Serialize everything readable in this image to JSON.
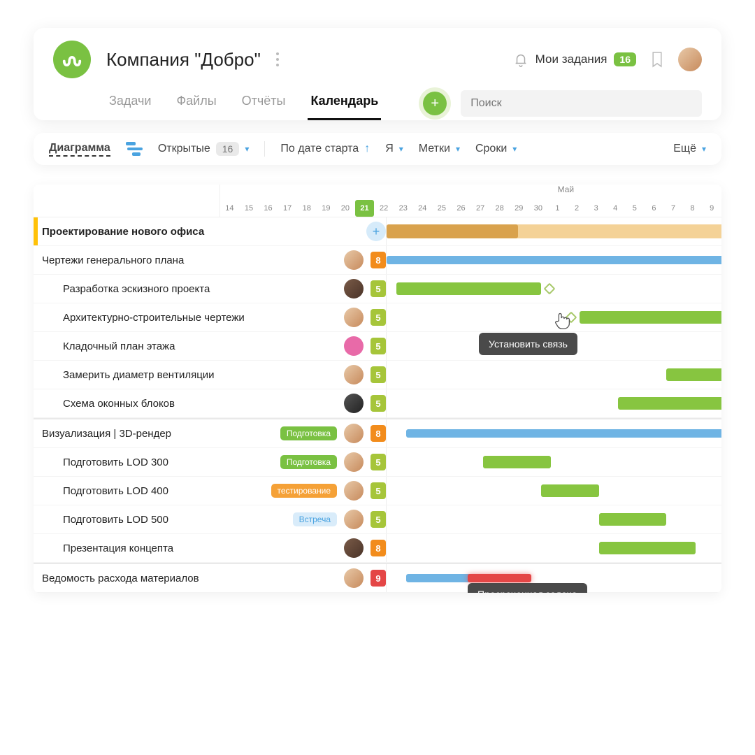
{
  "header": {
    "company_title": "Компания \"Добро\"",
    "my_tasks_label": "Мои задания",
    "my_tasks_count": "16",
    "search_placeholder": "Поиск",
    "tabs": {
      "tasks": "Задачи",
      "files": "Файлы",
      "reports": "Отчёты",
      "calendar": "Календарь"
    }
  },
  "filters": {
    "view_mode": "Диаграмма",
    "open_label": "Открытые",
    "open_count": "16",
    "sort_label": "По дате старта",
    "assignee_label": "Я",
    "tags_label": "Метки",
    "dates_label": "Сроки",
    "more_label": "Ещё"
  },
  "timeline": {
    "month_label": "Май",
    "days": [
      "14",
      "15",
      "16",
      "17",
      "18",
      "19",
      "20",
      "21",
      "22",
      "23",
      "24",
      "25",
      "26",
      "27",
      "28",
      "29",
      "30",
      "1",
      "2",
      "3",
      "4",
      "5",
      "6",
      "7",
      "8",
      "9"
    ],
    "today_index": 7
  },
  "tooltips": {
    "link": "Установить связь",
    "overdue": "Просроченная задача"
  },
  "tasks": [
    {
      "title": "Проектирование нового офиса",
      "kind": "section"
    },
    {
      "title": "Чертежи генерального плана",
      "badge": "8",
      "badge_color": "orange",
      "avatar": "tan"
    },
    {
      "title": "Разработка эскизного проекта",
      "badge": "5",
      "badge_color": "lime",
      "avatar": "brown",
      "indent": 2
    },
    {
      "title": "Архитектурно-строительные чертежи",
      "badge": "5",
      "badge_color": "lime",
      "avatar": "tan",
      "indent": 2
    },
    {
      "title": "Кладочный план этажа",
      "badge": "5",
      "badge_color": "lime",
      "avatar": "pink",
      "indent": 2
    },
    {
      "title": "Замерить диаметр вентиляции",
      "badge": "5",
      "badge_color": "lime",
      "avatar": "tan",
      "indent": 2
    },
    {
      "title": "Схема оконных блоков",
      "badge": "5",
      "badge_color": "lime",
      "avatar": "dark",
      "indent": 2
    },
    {
      "title": "Визуализация | 3D-рендер",
      "badge": "8",
      "badge_color": "orange",
      "avatar": "tan",
      "tag": "Подготовка",
      "tag_color": "green"
    },
    {
      "title": "Подготовить LOD 300",
      "badge": "5",
      "badge_color": "lime",
      "avatar": "tan",
      "indent": 2,
      "tag": "Подготовка",
      "tag_color": "green"
    },
    {
      "title": "Подготовить LOD 400",
      "badge": "5",
      "badge_color": "lime",
      "avatar": "tan",
      "indent": 2,
      "tag": "тестирование",
      "tag_color": "orange"
    },
    {
      "title": "Подготовить LOD 500",
      "badge": "5",
      "badge_color": "lime",
      "avatar": "tan",
      "indent": 2,
      "tag": "Встреча",
      "tag_color": "blue"
    },
    {
      "title": "Презентация концепта",
      "badge": "8",
      "badge_color": "orange",
      "avatar": "brown",
      "indent": 2
    },
    {
      "title": "Ведомость расхода материалов",
      "badge": "9",
      "badge_color": "red",
      "avatar": "tan"
    }
  ],
  "chart_data": {
    "type": "gantt",
    "x_unit": "day_index",
    "x_labels": [
      "14",
      "15",
      "16",
      "17",
      "18",
      "19",
      "20",
      "21",
      "22",
      "23",
      "24",
      "25",
      "26",
      "27",
      "28",
      "29",
      "30",
      "1",
      "2",
      "3",
      "4",
      "5",
      "6",
      "7",
      "8",
      "9"
    ],
    "today": 7,
    "bars": [
      {
        "row": 0,
        "start": 0,
        "end": 26,
        "style": "summary-pale"
      },
      {
        "row": 0,
        "start": 0,
        "end": 6.8,
        "style": "summary-brown"
      },
      {
        "row": 1,
        "start": 0,
        "end": 26,
        "style": "blue"
      },
      {
        "row": 2,
        "start": 0.5,
        "end": 8,
        "style": "green"
      },
      {
        "row": 3,
        "start": 10,
        "end": 26,
        "style": "green"
      },
      {
        "row": 5,
        "start": 14.5,
        "end": 26,
        "style": "green"
      },
      {
        "row": 6,
        "start": 12,
        "end": 26,
        "style": "green"
      },
      {
        "row": 7,
        "start": 1,
        "end": 26,
        "style": "blue"
      },
      {
        "row": 8,
        "start": 5,
        "end": 8.5,
        "style": "green"
      },
      {
        "row": 9,
        "start": 8,
        "end": 11,
        "style": "green"
      },
      {
        "row": 10,
        "start": 11,
        "end": 14.5,
        "style": "green"
      },
      {
        "row": 11,
        "start": 11,
        "end": 16,
        "style": "green"
      },
      {
        "row": 12,
        "start": 1,
        "end": 5,
        "style": "blue"
      },
      {
        "row": 12,
        "start": 4.2,
        "end": 7.5,
        "style": "red-overdue"
      }
    ],
    "dependencies": [
      {
        "from_row": 2,
        "to_row": 3
      },
      {
        "from_row": 3,
        "to_row": 5
      },
      {
        "from_row": 8,
        "to_row": 9
      },
      {
        "from_row": 9,
        "to_row": 10
      },
      {
        "from_row": 10,
        "to_row": 11
      }
    ]
  }
}
